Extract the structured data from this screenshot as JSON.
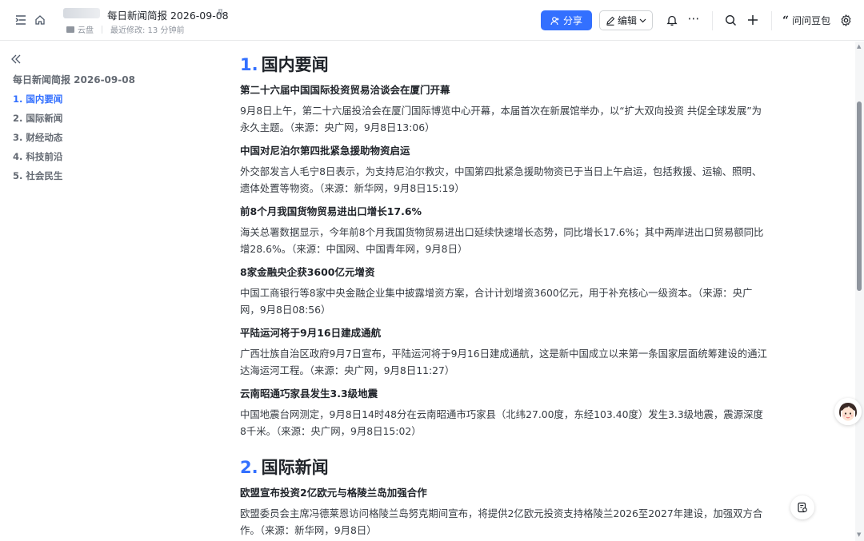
{
  "header": {
    "doc_title": "每日新闻简报 2026-09-08",
    "location": "云盘",
    "last_modified": "最近修改: 13 分钟前",
    "share_label": "分享",
    "edit_label": "编辑",
    "ask_label": "问问豆包"
  },
  "sidebar": {
    "title": "每日新闻简报 2026-09-08",
    "items": [
      {
        "label": "1. 国内要闻",
        "active": true
      },
      {
        "label": "2. 国际新闻",
        "active": false
      },
      {
        "label": "3. 财经动态",
        "active": false
      },
      {
        "label": "4. 科技前沿",
        "active": false
      },
      {
        "label": "5. 社会民生",
        "active": false
      }
    ]
  },
  "content": {
    "sections": [
      {
        "num": "1.",
        "title": "国内要闻",
        "articles": [
          {
            "title": "第二十六届中国国际投资贸易洽谈会在厦门开幕",
            "body": "9月8日上午，第二十六届投洽会在厦门国际博览中心开幕，本届首次在新展馆举办，以“扩大双向投资 共促全球发展”为永久主题。（来源：央广网，9月8日13:06）"
          },
          {
            "title": "中国对尼泊尔第四批紧急援助物资启运",
            "body": "外交部发言人毛宁8日表示，为支持尼泊尔救灾，中国第四批紧急援助物资已于当日上午启运，包括救援、运输、照明、遗体处置等物资。（来源：新华网，9月8日15:19）"
          },
          {
            "title": "前8个月我国货物贸易进出口增长17.6%",
            "body": "海关总署数据显示，今年前8个月我国货物贸易进出口延续快速增长态势，同比增长17.6%；其中两岸进出口贸易额同比增28.6%。（来源：中国网、中国青年网，9月8日）"
          },
          {
            "title": "8家金融央企获3600亿元增资",
            "body": "中国工商银行等8家中央金融企业集中披露增资方案，合计计划增资3600亿元，用于补充核心一级资本。（来源：央广网，9月8日08:56）"
          },
          {
            "title": "平陆运河将于9月16日建成通航",
            "body": "广西壮族自治区政府9月7日宣布，平陆运河将于9月16日建成通航，这是新中国成立以来第一条国家层面统筹建设的通江达海运河工程。（来源：央广网，9月8日11:27）"
          },
          {
            "title": "云南昭通巧家县发生3.3级地震",
            "body": "中国地震台网测定，9月8日14时48分在云南昭通市巧家县（北纬27.00度，东经103.40度）发生3.3级地震，震源深度8千米。（来源：央广网，9月8日15:02）"
          }
        ]
      },
      {
        "num": "2.",
        "title": "国际新闻",
        "articles": [
          {
            "title": "欧盟宣布投资2亿欧元与格陵兰岛加强合作",
            "body": "欧盟委员会主席冯德莱恩访问格陵兰岛努克期间宣布，将提供2亿欧元投资支持格陵兰2026至2027年建设，加强双方合作。（来源：新华网，9月8日）"
          }
        ]
      }
    ]
  },
  "colors": {
    "accent": "#3370ff",
    "text": "#1f2329",
    "muted": "#646a73"
  }
}
